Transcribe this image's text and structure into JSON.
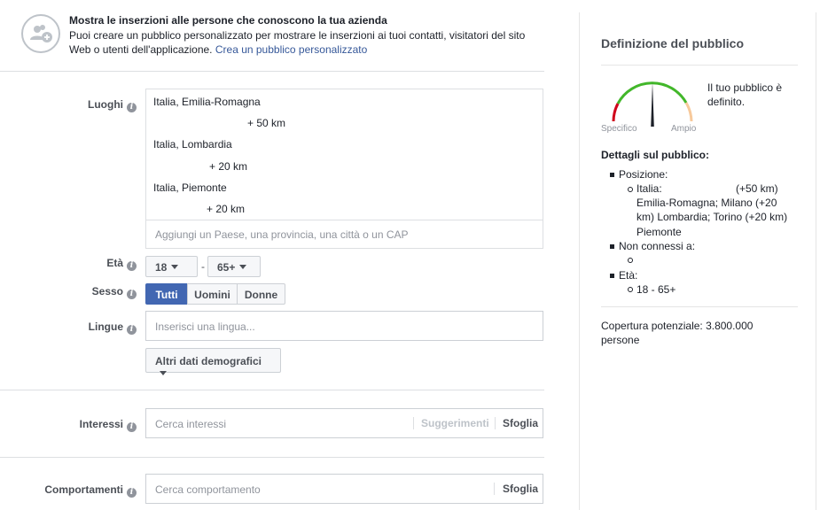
{
  "banner": {
    "title": "Mostra le inserzioni alle persone che conoscono la tua azienda",
    "text": "Puoi creare un pubblico personalizzato per mostrare le inserzioni ai tuoi contatti, visitatori del sito Web o utenti dell'applicazione.",
    "link": "Crea un pubblico personalizzato",
    "icon": "people-add-icon"
  },
  "locations": {
    "label": "Luoghi",
    "items": [
      {
        "place": "Italia, Emilia-Romagna",
        "radius": "+ 50 km"
      },
      {
        "place": "Italia, Lombardia",
        "radius": "+ 20 km"
      },
      {
        "place": "Italia, Piemonte",
        "radius": "+ 20 km"
      }
    ],
    "placeholder": "Aggiungi un Paese, una provincia, una città o un CAP"
  },
  "age": {
    "label": "Età",
    "min": "18",
    "sep": "-",
    "max": "65+"
  },
  "gender": {
    "label": "Sesso",
    "options": [
      "Tutti",
      "Uomini",
      "Donne"
    ],
    "selected": "Tutti"
  },
  "languages": {
    "label": "Lingue",
    "placeholder": "Inserisci una lingua..."
  },
  "more_demographics": {
    "label": "Altri dati demografici"
  },
  "interests": {
    "label": "Interessi",
    "placeholder": "Cerca interessi",
    "suggestions": "Suggerimenti",
    "browse": "Sfoglia"
  },
  "behaviors": {
    "label": "Comportamenti",
    "placeholder": "Cerca comportamento",
    "browse": "Sfoglia"
  },
  "audience": {
    "title": "Definizione del pubblico",
    "gauge_left": "Specifico",
    "gauge_right": "Ampio",
    "status": "Il tuo pubblico è definito.",
    "details_title": "Dettagli sul pubblico:",
    "position_label": "Posizione:",
    "position_line1": "Italia:",
    "position_line1b": "(+50 km)",
    "position_line2": "Emilia-Romagna; Milano (+20",
    "position_line3": "km) Lombardia; Torino (+20 km)",
    "position_line4": "Piemonte",
    "not_connected_label": "Non connessi a:",
    "age_label": "Età:",
    "age_value": "18 - 65+",
    "coverage": "Copertura potenziale: 3.800.000 persone"
  },
  "colors": {
    "accent": "#4267b2",
    "link": "#365899",
    "gauge_green": "#42b72a",
    "gauge_red": "#d0021b",
    "gauge_orange": "#f7c99b"
  }
}
